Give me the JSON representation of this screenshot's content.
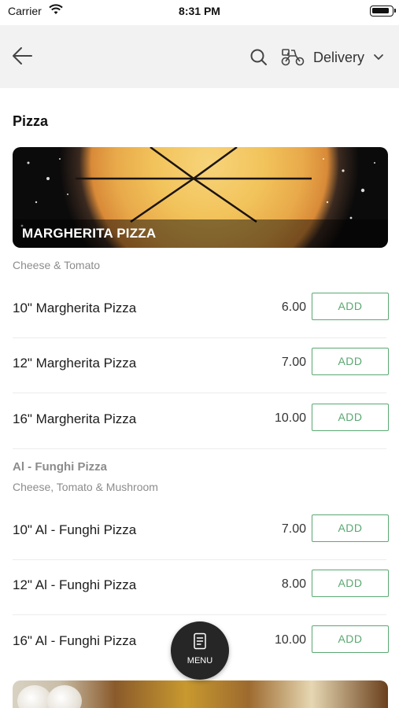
{
  "status_bar": {
    "carrier": "Carrier",
    "time": "8:31 PM"
  },
  "header": {
    "delivery_label": "Delivery"
  },
  "section": {
    "title": "Pizza",
    "banner_title": "MARGHERITA PIZZA",
    "category_description": "Cheese & Tomato"
  },
  "margherita_items": [
    {
      "name": "10\" Margherita Pizza",
      "price": "6.00",
      "add_label": "ADD"
    },
    {
      "name": "12\" Margherita Pizza",
      "price": "7.00",
      "add_label": "ADD"
    },
    {
      "name": "16\" Margherita Pizza",
      "price": "10.00",
      "add_label": "ADD"
    }
  ],
  "funghi": {
    "title": "Al - Funghi Pizza",
    "description": "Cheese, Tomato & Mushroom",
    "items": [
      {
        "name": "10\" Al - Funghi Pizza",
        "price": "7.00",
        "add_label": "ADD"
      },
      {
        "name": "12\" Al - Funghi Pizza",
        "price": "8.00",
        "add_label": "ADD"
      },
      {
        "name": "16\" Al - Funghi Pizza",
        "price": "10.00",
        "add_label": "ADD"
      }
    ]
  },
  "menu_button": {
    "label": "MENU"
  },
  "colors": {
    "accent_green": "#5aa871",
    "header_bg": "#f2f2f2",
    "fab_bg": "#262626"
  }
}
